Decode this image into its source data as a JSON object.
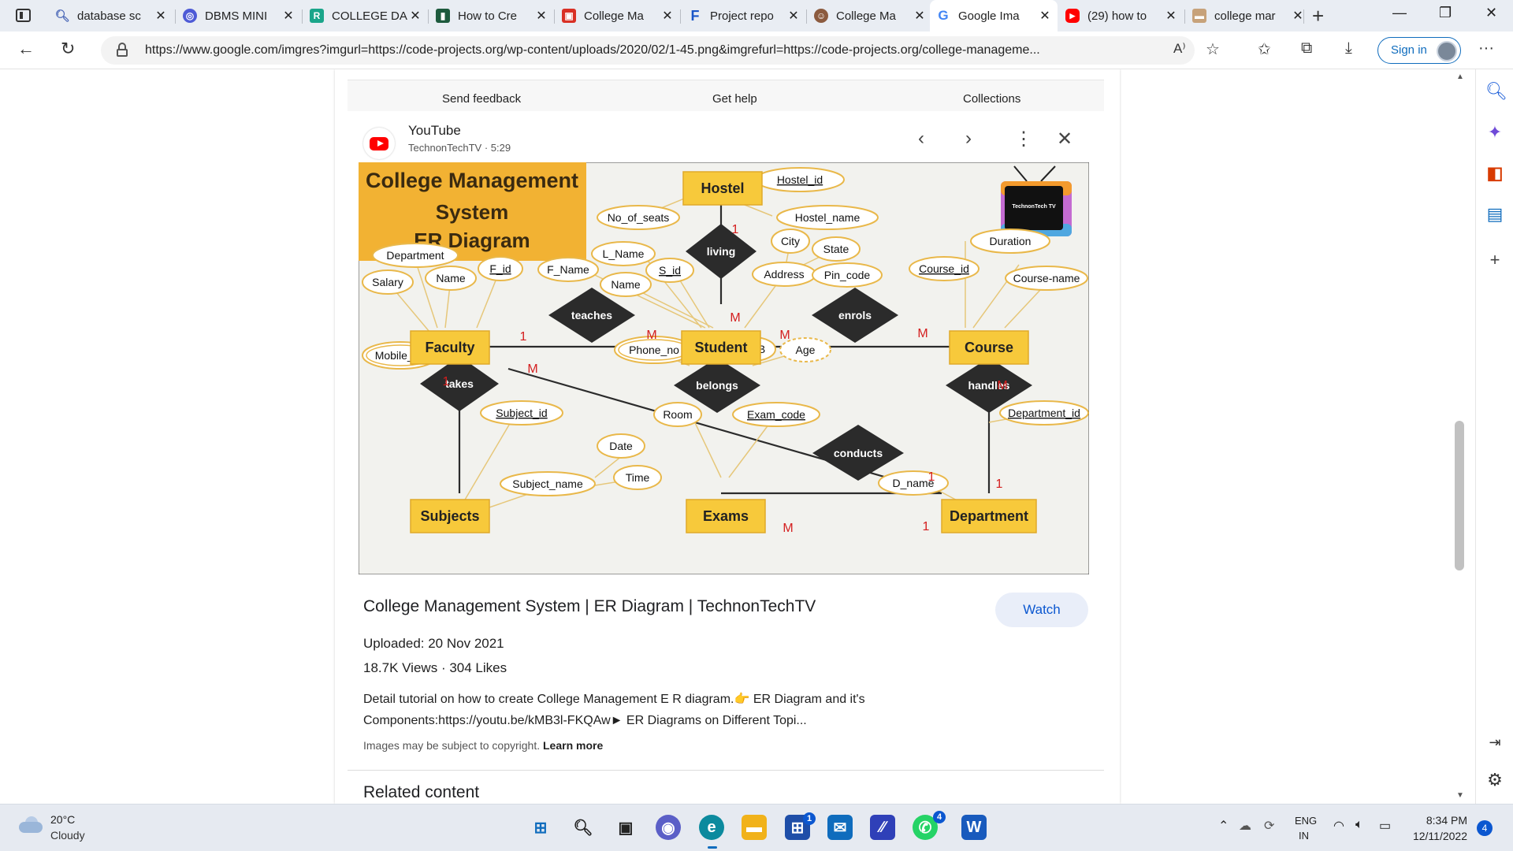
{
  "tabs": [
    {
      "title": "database sc",
      "favicon": "search-icon",
      "color": "#4a67b7"
    },
    {
      "title": "DBMS MINI",
      "favicon": "app-icon",
      "color": "#4e5bd6"
    },
    {
      "title": "COLLEGE DA",
      "favicon": "r-icon",
      "color": "#1aa58a"
    },
    {
      "title": "How to Cre",
      "favicon": "doc-icon",
      "color": "#1d5a3d"
    },
    {
      "title": "College Ma",
      "favicon": "slides-icon",
      "color": "#d93025"
    },
    {
      "title": "Project repo",
      "favicon": "f-icon",
      "color": "#1a56c8"
    },
    {
      "title": "College Ma",
      "favicon": "avatar-icon",
      "color": "#8c5b3f"
    },
    {
      "title": "Google Ima",
      "favicon": "google-icon",
      "color": "#4285f4"
    },
    {
      "title": "(29) how to",
      "favicon": "youtube-icon",
      "color": "#ff0000"
    },
    {
      "title": "college mar",
      "favicon": "site-icon",
      "color": "#c7a27a"
    }
  ],
  "address": {
    "url": "https://www.google.com/imgres?imgurl=https://code-projects.org/wp-content/uploads/2020/02/1-45.png&imgrefurl=https://code-projects.org/college-manageme..."
  },
  "toolbar": {
    "signin_label": "Sign in"
  },
  "feedback_bar": {
    "send_feedback": "Send feedback",
    "get_help": "Get help",
    "collections": "Collections"
  },
  "source": {
    "name": "YouTube",
    "channel": "TechnonTechTV · 5:29"
  },
  "er": {
    "title_lines": [
      "College Management",
      "System",
      "ER Diagram"
    ],
    "logo_text": "TechnonTech TV",
    "entities": [
      {
        "id": "hostel",
        "label": "Hostel"
      },
      {
        "id": "faculty",
        "label": "Faculty"
      },
      {
        "id": "student",
        "label": "Student"
      },
      {
        "id": "course",
        "label": "Course"
      },
      {
        "id": "subjects",
        "label": "Subjects"
      },
      {
        "id": "exams",
        "label": "Exams"
      },
      {
        "id": "department",
        "label": "Department"
      }
    ],
    "relations": [
      {
        "id": "living",
        "label": "living"
      },
      {
        "id": "teaches",
        "label": "teaches"
      },
      {
        "id": "enrols",
        "label": "enrols"
      },
      {
        "id": "takes",
        "label": "takes"
      },
      {
        "id": "belongs",
        "label": "belongs"
      },
      {
        "id": "handles",
        "label": "handles"
      },
      {
        "id": "conducts",
        "label": "conducts"
      }
    ],
    "attributes": [
      "Hostel_id",
      "No_of_seats",
      "Hostel_name",
      "Department",
      "F_id",
      "Name",
      "Salary",
      "Mobile_no",
      "L_Name",
      "F_Name",
      "S_id",
      "Name",
      "City",
      "State",
      "Address",
      "Pin_code",
      "Phone_no",
      "DOB",
      "Age",
      "Duration",
      "Course_id",
      "Course-name",
      "Subject_id",
      "Subject_name",
      "Room",
      "Exam_code",
      "Date",
      "Time",
      "Department_id",
      "D_name"
    ],
    "cardinalities": [
      "1",
      "M",
      "1",
      "M",
      "M",
      "M",
      "1",
      "M",
      "M",
      "1",
      "1",
      "M",
      "1"
    ]
  },
  "video": {
    "title": "College Management System | ER Diagram | TechnonTechTV",
    "watch_label": "Watch",
    "uploaded": "Uploaded: 20 Nov 2021",
    "views": "18.7K Views",
    "likes": "304 Likes",
    "desc_line1": "Detail tutorial on how to create College Management E R diagram.👉 ER Diagram and it's",
    "desc_line2": "Components:https://youtu.be/kMB3l-FKQAw► ER Diagrams on Different Topi...",
    "copyright": "Images may be subject to copyright.",
    "learn_more": "Learn more",
    "related": "Related content"
  },
  "taskbar": {
    "temp": "20°C",
    "condition": "Cloudy",
    "lang": "ENG",
    "region": "IN",
    "time": "8:34 PM",
    "date": "12/11/2022",
    "notifications": "4",
    "store_badge": "1",
    "whatsapp_badge": "4"
  },
  "colors": {
    "accent": "#0b57d0",
    "entity": "#f7c93b",
    "relation": "#2b2b2b",
    "cardinality": "#d41e1e",
    "er_title_bg": "#f2b233"
  }
}
